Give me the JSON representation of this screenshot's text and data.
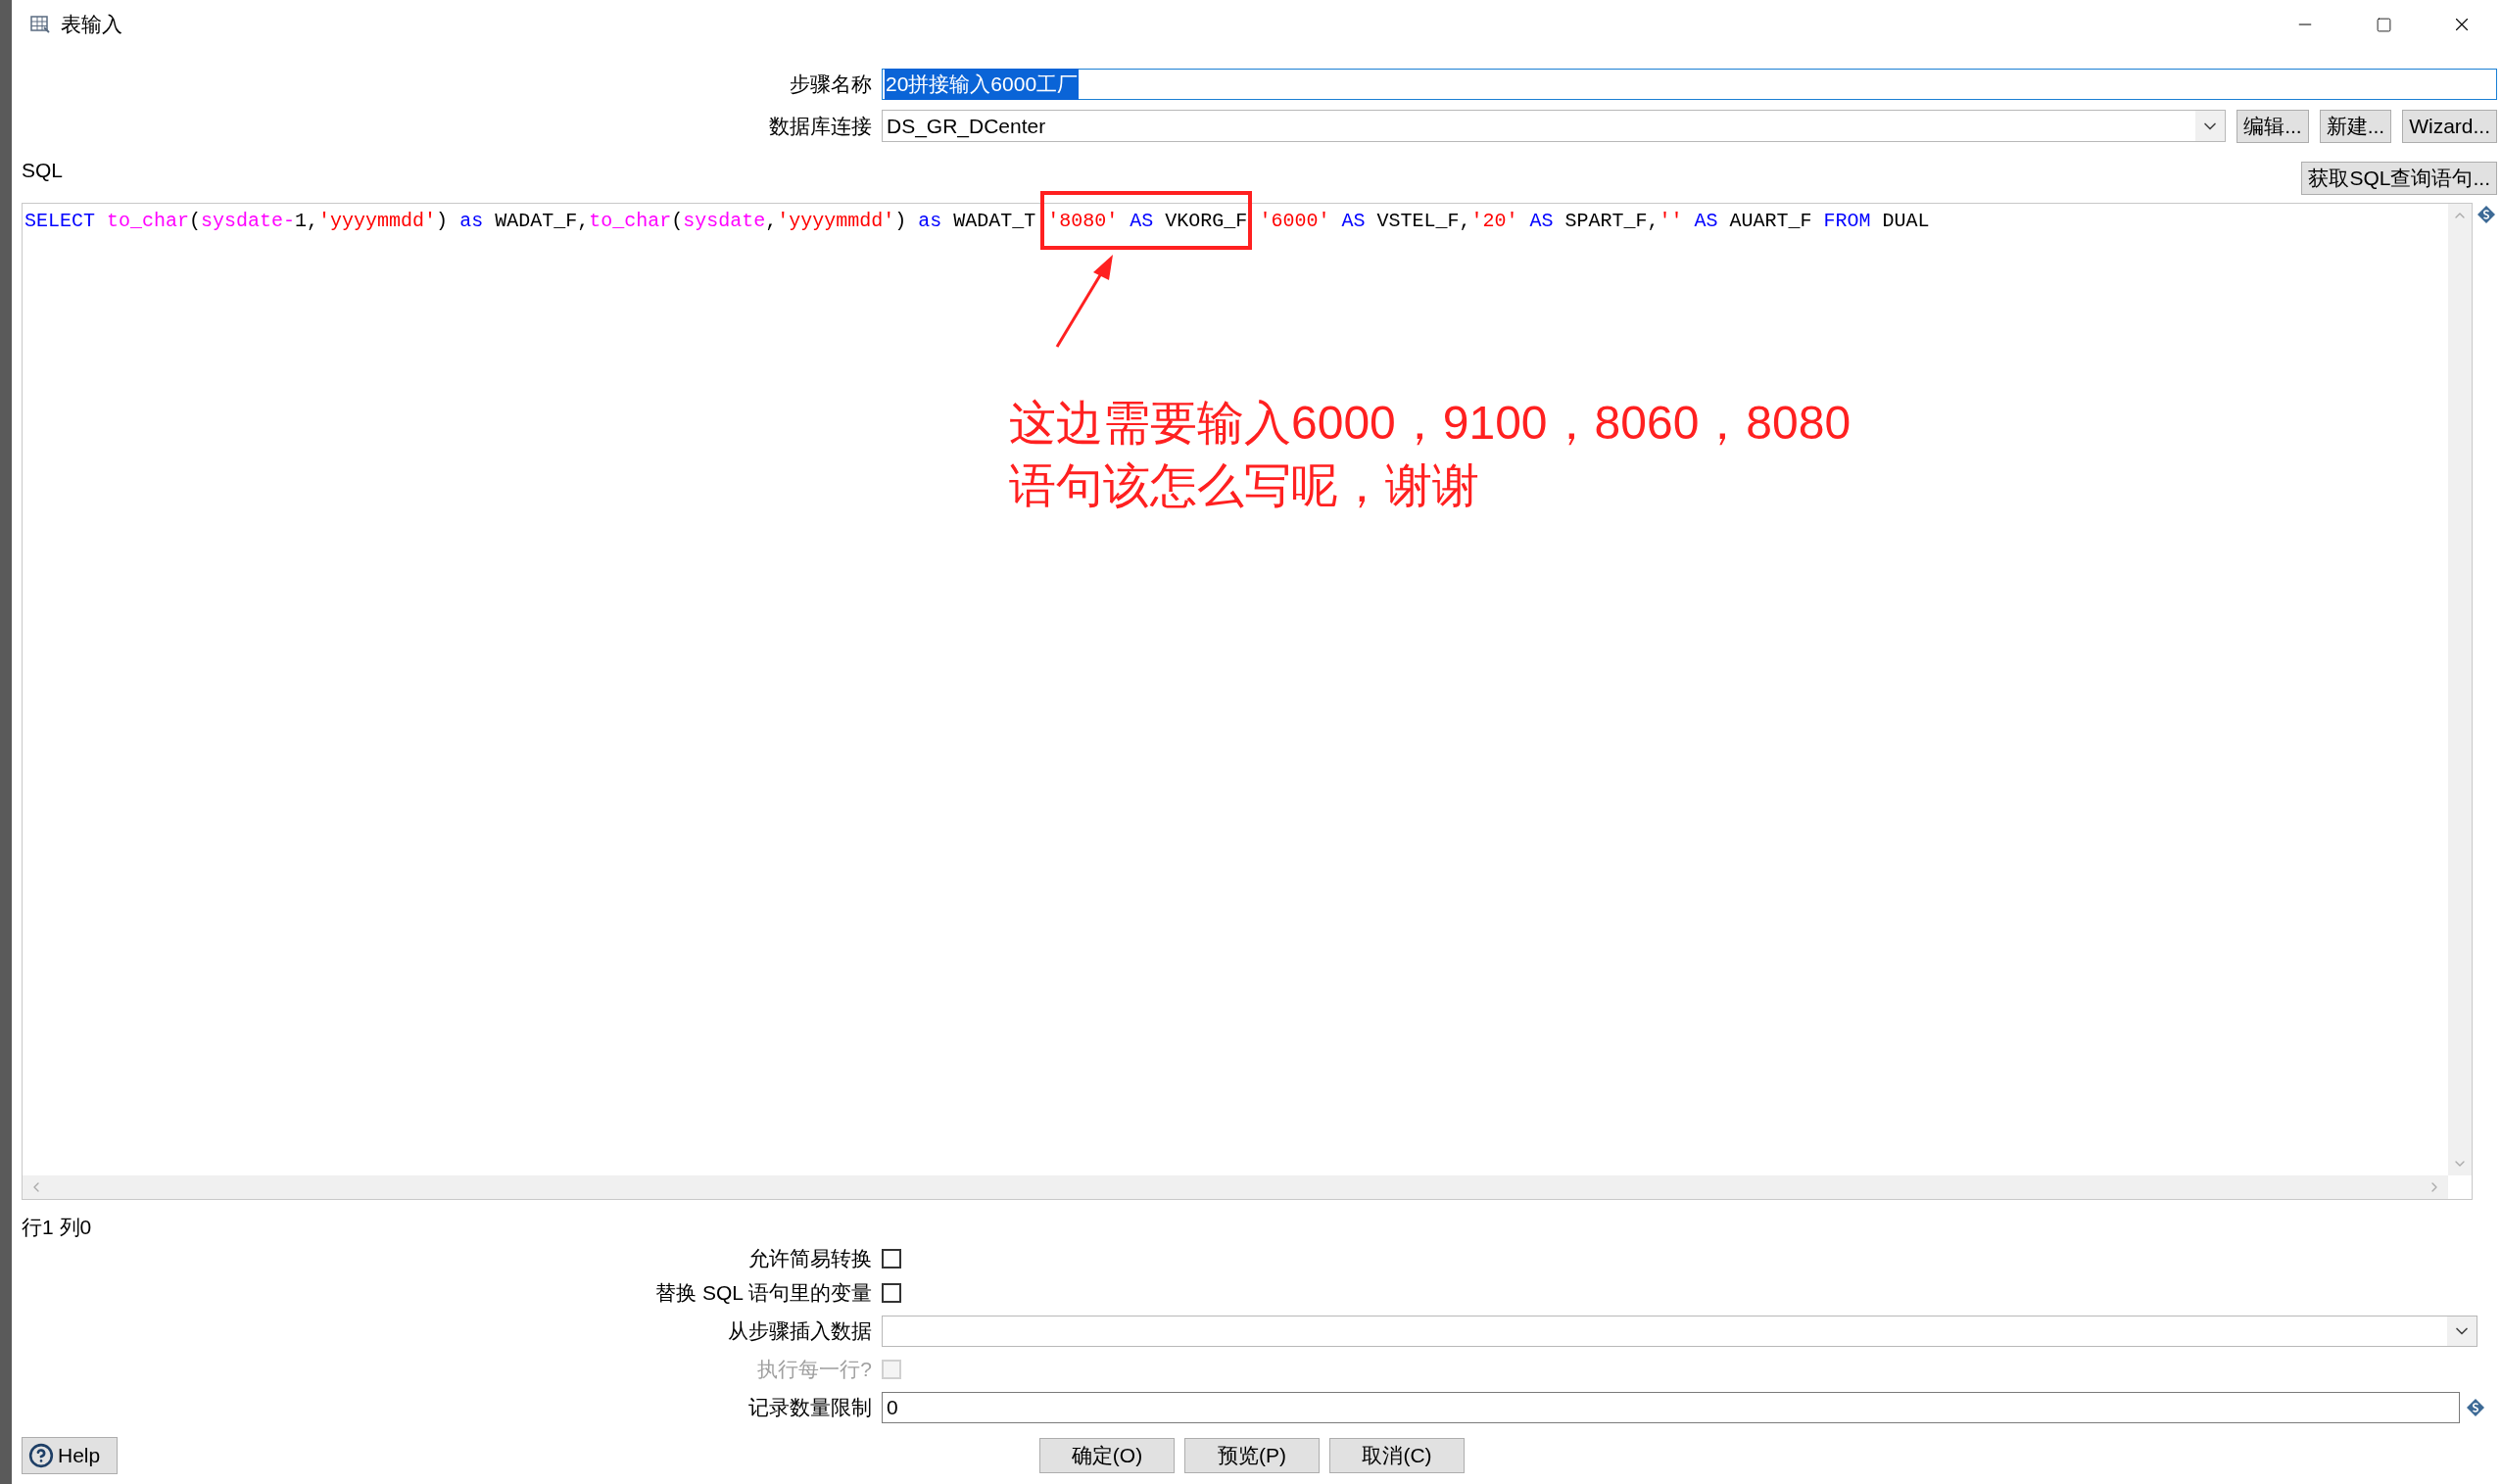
{
  "window": {
    "title": "表输入"
  },
  "step_name": {
    "label": "步骤名称",
    "value": "20拼接输入6000工厂",
    "text_selected": true
  },
  "connection": {
    "label": "数据库连接",
    "value": "DS_GR_DCenter",
    "buttons": [
      "编辑...",
      "新建...",
      "Wizard..."
    ]
  },
  "sql": {
    "label": "SQL",
    "get_button": "获取SQL查询语句...",
    "tokens": [
      {
        "kind": "keyword",
        "text": "SELECT "
      },
      {
        "kind": "function",
        "text": "to_char"
      },
      {
        "kind": "plain",
        "text": "("
      },
      {
        "kind": "function",
        "text": "sysdate-"
      },
      {
        "kind": "plain",
        "text": "1,"
      },
      {
        "kind": "string",
        "text": "'yyyymmdd'"
      },
      {
        "kind": "plain",
        "text": ") "
      },
      {
        "kind": "keyword",
        "text": "as"
      },
      {
        "kind": "plain",
        "text": " WADAT_F,"
      },
      {
        "kind": "function",
        "text": "to_char"
      },
      {
        "kind": "plain",
        "text": "("
      },
      {
        "kind": "function",
        "text": "sysdate"
      },
      {
        "kind": "plain",
        "text": ","
      },
      {
        "kind": "string",
        "text": "'yyyymmdd'"
      },
      {
        "kind": "plain",
        "text": ") "
      },
      {
        "kind": "keyword",
        "text": "as"
      },
      {
        "kind": "plain",
        "text": " WADAT_T "
      },
      {
        "kind": "string",
        "text": "'8080' "
      },
      {
        "kind": "keyword",
        "text": "AS"
      },
      {
        "kind": "plain",
        "text": " VKORG_F "
      },
      {
        "kind": "string",
        "text": "'6000' "
      },
      {
        "kind": "keyword",
        "text": "AS"
      },
      {
        "kind": "plain",
        "text": " VSTEL_F,"
      },
      {
        "kind": "string",
        "text": "'20' "
      },
      {
        "kind": "keyword",
        "text": "AS"
      },
      {
        "kind": "plain",
        "text": " SPART_F,"
      },
      {
        "kind": "string",
        "text": "'' "
      },
      {
        "kind": "keyword",
        "text": "AS"
      },
      {
        "kind": "plain",
        "text": " AUART_F "
      },
      {
        "kind": "keyword",
        "text": "FROM"
      },
      {
        "kind": "plain",
        "text": " DUAL"
      }
    ]
  },
  "annotation": {
    "lines": [
      "这边需要输入6000，9100，8060，8080",
      "语句该怎么写呢，谢谢"
    ]
  },
  "cursor_status": "行1 列0",
  "options": [
    {
      "kind": "checkbox",
      "label": "允许简易转换",
      "checked": false,
      "disabled": false
    },
    {
      "kind": "checkbox",
      "label": "替换 SQL 语句里的变量",
      "checked": false,
      "disabled": false
    },
    {
      "kind": "dropdown",
      "label": "从步骤插入数据"
    },
    {
      "kind": "checkbox",
      "label": "执行每一行?",
      "checked": false,
      "disabled": true
    },
    {
      "kind": "text",
      "label": "记录数量限制",
      "value": "0"
    }
  ],
  "footer": {
    "help": "Help",
    "buttons": [
      "确定(O)",
      "预览(P)",
      "取消(C)"
    ]
  }
}
